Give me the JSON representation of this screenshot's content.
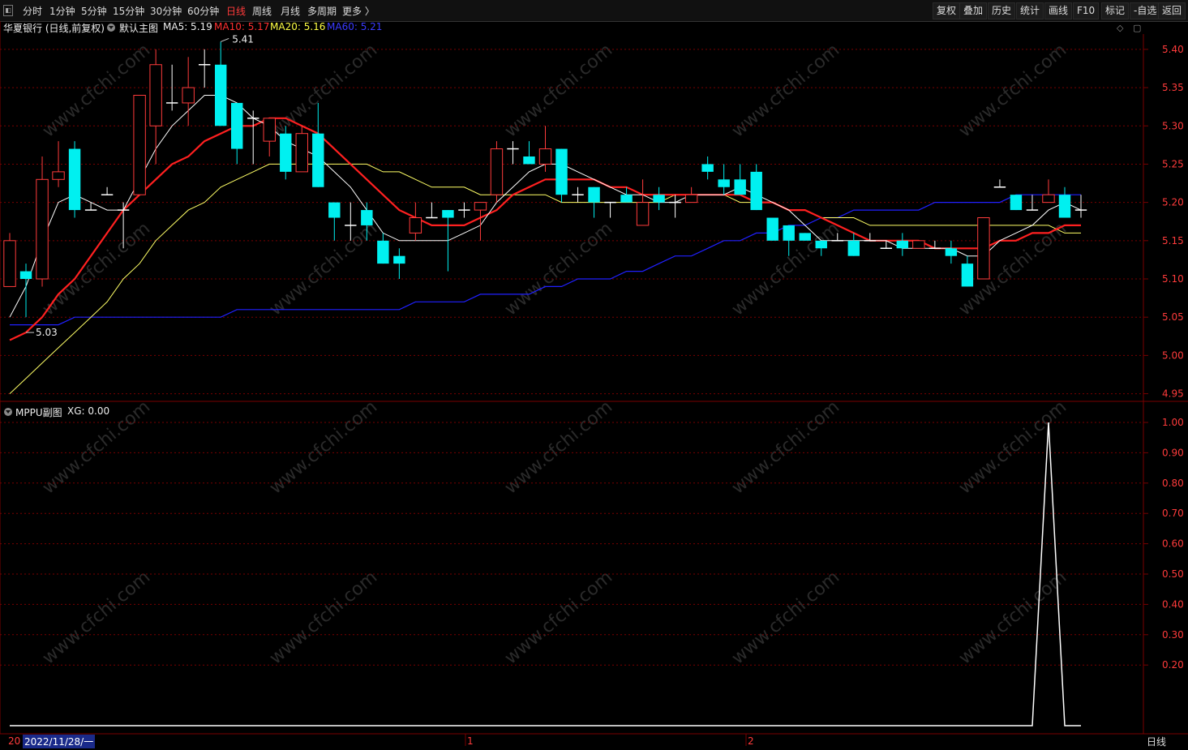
{
  "toolbar": {
    "left": [
      {
        "label": "分时",
        "active": false
      },
      {
        "label": "1分钟",
        "active": false
      },
      {
        "label": "5分钟",
        "active": false
      },
      {
        "label": "15分钟",
        "active": false
      },
      {
        "label": "30分钟",
        "active": false
      },
      {
        "label": "60分钟",
        "active": false
      },
      {
        "label": "日线",
        "active": true
      },
      {
        "label": "周线",
        "active": false
      },
      {
        "label": "月线",
        "active": false
      },
      {
        "label": "多周期",
        "active": false
      },
      {
        "label": "更多 〉",
        "active": false
      }
    ],
    "right": [
      "复权",
      "叠加",
      "历史",
      "统计",
      "画线",
      "F10",
      "标记",
      "-自选",
      "返回"
    ]
  },
  "main_info": {
    "stock": "华夏银行 (日线,前复权)",
    "template": "默认主图",
    "ma5": "MA5: 5.19",
    "ma10": "MA10: 5.17",
    "ma20": "MA20: 5.16",
    "ma60": "MA60: 5.21"
  },
  "sub_info": {
    "indicator": "MPPU副图",
    "xg": "XG: 0.00"
  },
  "colors": {
    "up": "#ff3b3b",
    "down": "#00f0f0",
    "ma5": "#ffffff",
    "ma10": "#ff2020",
    "ma20": "#ffff66",
    "ma60": "#2020ff",
    "grid": "#7a0000",
    "axis_text": "#ff3b3b"
  },
  "price_axis": {
    "ticks": [
      "5.40",
      "5.35",
      "5.30",
      "5.25",
      "5.20",
      "5.15",
      "5.10",
      "5.05",
      "5.00",
      "4.95"
    ]
  },
  "sub_axis": {
    "ticks": [
      "1.00",
      "0.90",
      "0.80",
      "0.70",
      "0.60",
      "0.50",
      "0.40",
      "0.30",
      "0.20"
    ]
  },
  "annotations": {
    "high": "5.41",
    "low": "5.03"
  },
  "bottom": {
    "date": "2022/11/28/一",
    "year_prefix": "20",
    "m1": "1",
    "m2": "2",
    "period": "日线"
  },
  "watermark": "www.cfchi.com",
  "chart_data": {
    "type": "candlestick",
    "candles": [
      [
        5.09,
        5.15,
        5.09,
        5.16
      ],
      [
        5.11,
        5.1,
        5.05,
        5.12
      ],
      [
        5.1,
        5.23,
        5.09,
        5.26
      ],
      [
        5.23,
        5.24,
        5.22,
        5.28
      ],
      [
        5.27,
        5.19,
        5.18,
        5.28
      ],
      [
        5.19,
        5.19,
        5.19,
        5.2
      ],
      [
        5.21,
        5.21,
        5.21,
        5.22
      ],
      [
        5.19,
        5.19,
        5.14,
        5.2
      ],
      [
        5.21,
        5.34,
        5.21,
        5.34
      ],
      [
        5.3,
        5.38,
        5.25,
        5.4
      ],
      [
        5.33,
        5.33,
        5.32,
        5.38
      ],
      [
        5.33,
        5.35,
        5.3,
        5.39
      ],
      [
        5.38,
        5.38,
        5.35,
        5.4
      ],
      [
        5.38,
        5.3,
        5.3,
        5.41
      ],
      [
        5.33,
        5.27,
        5.25,
        5.33
      ],
      [
        5.31,
        5.31,
        5.25,
        5.32
      ],
      [
        5.28,
        5.31,
        5.26,
        5.31
      ],
      [
        5.29,
        5.24,
        5.23,
        5.3
      ],
      [
        5.24,
        5.29,
        5.24,
        5.3
      ],
      [
        5.29,
        5.22,
        5.22,
        5.33
      ],
      [
        5.2,
        5.18,
        5.15,
        5.2
      ],
      [
        5.17,
        5.17,
        5.15,
        5.2
      ],
      [
        5.19,
        5.17,
        5.15,
        5.2
      ],
      [
        5.15,
        5.12,
        5.12,
        5.16
      ],
      [
        5.13,
        5.12,
        5.1,
        5.14
      ],
      [
        5.16,
        5.18,
        5.15,
        5.2
      ],
      [
        5.18,
        5.18,
        5.18,
        5.2
      ],
      [
        5.19,
        5.18,
        5.11,
        5.19
      ],
      [
        5.19,
        5.19,
        5.18,
        5.2
      ],
      [
        5.19,
        5.2,
        5.15,
        5.2
      ],
      [
        5.21,
        5.27,
        5.2,
        5.28
      ],
      [
        5.27,
        5.27,
        5.25,
        5.28
      ],
      [
        5.26,
        5.25,
        5.25,
        5.28
      ],
      [
        5.25,
        5.27,
        5.24,
        5.3
      ],
      [
        5.27,
        5.21,
        5.2,
        5.27
      ],
      [
        5.21,
        5.21,
        5.2,
        5.22
      ],
      [
        5.22,
        5.2,
        5.18,
        5.22
      ],
      [
        5.2,
        5.2,
        5.18,
        5.2
      ],
      [
        5.21,
        5.2,
        5.2,
        5.22
      ],
      [
        5.17,
        5.2,
        5.17,
        5.23
      ],
      [
        5.21,
        5.2,
        5.19,
        5.22
      ],
      [
        5.2,
        5.2,
        5.18,
        5.21
      ],
      [
        5.2,
        5.21,
        5.2,
        5.22
      ],
      [
        5.25,
        5.24,
        5.23,
        5.26
      ],
      [
        5.23,
        5.22,
        5.21,
        5.25
      ],
      [
        5.23,
        5.21,
        5.21,
        5.25
      ],
      [
        5.24,
        5.19,
        5.19,
        5.25
      ],
      [
        5.18,
        5.15,
        5.15,
        5.18
      ],
      [
        5.17,
        5.15,
        5.13,
        5.17
      ],
      [
        5.16,
        5.15,
        5.15,
        5.16
      ],
      [
        5.15,
        5.14,
        5.13,
        5.15
      ],
      [
        5.15,
        5.15,
        5.15,
        5.16
      ],
      [
        5.15,
        5.13,
        5.13,
        5.16
      ],
      [
        5.15,
        5.15,
        5.15,
        5.16
      ],
      [
        5.14,
        5.14,
        5.14,
        5.15
      ],
      [
        5.15,
        5.14,
        5.13,
        5.16
      ],
      [
        5.14,
        5.15,
        5.15,
        5.15
      ],
      [
        5.14,
        5.14,
        5.14,
        5.15
      ],
      [
        5.14,
        5.13,
        5.12,
        5.15
      ],
      [
        5.12,
        5.09,
        5.09,
        5.13
      ],
      [
        5.1,
        5.18,
        5.1,
        5.18
      ],
      [
        5.22,
        5.22,
        5.22,
        5.23
      ],
      [
        5.21,
        5.19,
        5.19,
        5.21
      ],
      [
        5.19,
        5.19,
        5.19,
        5.21
      ],
      [
        5.2,
        5.21,
        5.2,
        5.23
      ],
      [
        5.21,
        5.18,
        5.18,
        5.22
      ],
      [
        5.19,
        5.19,
        5.18,
        5.21
      ]
    ],
    "ma5": [
      5.05,
      5.09,
      5.15,
      5.2,
      5.21,
      5.2,
      5.19,
      5.19,
      5.23,
      5.27,
      5.3,
      5.32,
      5.34,
      5.34,
      5.33,
      5.31,
      5.3,
      5.28,
      5.27,
      5.26,
      5.24,
      5.22,
      5.19,
      5.16,
      5.15,
      5.15,
      5.15,
      5.15,
      5.16,
      5.17,
      5.2,
      5.22,
      5.24,
      5.25,
      5.25,
      5.24,
      5.23,
      5.22,
      5.21,
      5.21,
      5.2,
      5.2,
      5.21,
      5.21,
      5.21,
      5.22,
      5.21,
      5.2,
      5.19,
      5.17,
      5.15,
      5.15,
      5.15,
      5.15,
      5.15,
      5.14,
      5.14,
      5.14,
      5.14,
      5.13,
      5.13,
      5.15,
      5.16,
      5.17,
      5.19,
      5.2,
      5.19
    ],
    "ma10": [
      5.02,
      5.03,
      5.05,
      5.08,
      5.1,
      5.13,
      5.16,
      5.19,
      5.21,
      5.23,
      5.25,
      5.26,
      5.28,
      5.29,
      5.3,
      5.3,
      5.31,
      5.31,
      5.3,
      5.29,
      5.27,
      5.25,
      5.23,
      5.21,
      5.19,
      5.18,
      5.17,
      5.17,
      5.17,
      5.18,
      5.19,
      5.21,
      5.22,
      5.23,
      5.23,
      5.23,
      5.23,
      5.22,
      5.22,
      5.21,
      5.21,
      5.21,
      5.21,
      5.21,
      5.21,
      5.21,
      5.2,
      5.2,
      5.19,
      5.19,
      5.18,
      5.17,
      5.16,
      5.15,
      5.15,
      5.15,
      5.15,
      5.14,
      5.14,
      5.14,
      5.14,
      5.15,
      5.15,
      5.16,
      5.16,
      5.17,
      5.17
    ],
    "ma20": [
      4.95,
      4.97,
      4.99,
      5.01,
      5.03,
      5.05,
      5.07,
      5.1,
      5.12,
      5.15,
      5.17,
      5.19,
      5.2,
      5.22,
      5.23,
      5.24,
      5.25,
      5.25,
      5.25,
      5.25,
      5.25,
      5.25,
      5.25,
      5.24,
      5.24,
      5.23,
      5.22,
      5.22,
      5.22,
      5.21,
      5.21,
      5.21,
      5.21,
      5.21,
      5.2,
      5.2,
      5.2,
      5.2,
      5.2,
      5.2,
      5.2,
      5.21,
      5.21,
      5.21,
      5.21,
      5.2,
      5.2,
      5.2,
      5.19,
      5.19,
      5.18,
      5.18,
      5.18,
      5.17,
      5.17,
      5.17,
      5.17,
      5.17,
      5.17,
      5.17,
      5.17,
      5.17,
      5.17,
      5.17,
      5.17,
      5.16,
      5.16
    ],
    "ma60": [
      5.04,
      5.04,
      5.04,
      5.04,
      5.05,
      5.05,
      5.05,
      5.05,
      5.05,
      5.05,
      5.05,
      5.05,
      5.05,
      5.05,
      5.06,
      5.06,
      5.06,
      5.06,
      5.06,
      5.06,
      5.06,
      5.06,
      5.06,
      5.06,
      5.06,
      5.07,
      5.07,
      5.07,
      5.07,
      5.08,
      5.08,
      5.08,
      5.08,
      5.09,
      5.09,
      5.1,
      5.1,
      5.1,
      5.11,
      5.11,
      5.12,
      5.13,
      5.13,
      5.14,
      5.15,
      5.15,
      5.16,
      5.16,
      5.17,
      5.17,
      5.18,
      5.18,
      5.19,
      5.19,
      5.19,
      5.19,
      5.19,
      5.2,
      5.2,
      5.2,
      5.2,
      5.2,
      5.21,
      5.21,
      5.21,
      5.21,
      5.21
    ],
    "price_ylim": [
      4.94,
      5.42
    ],
    "mppu": [
      0,
      0,
      0,
      0,
      0,
      0,
      0,
      0,
      0,
      0,
      0,
      0,
      0,
      0,
      0,
      0,
      0,
      0,
      0,
      0,
      0,
      0,
      0,
      0,
      0,
      0,
      0,
      0,
      0,
      0,
      0,
      0,
      0,
      0,
      0,
      0,
      0,
      0,
      0,
      0,
      0,
      0,
      0,
      0,
      0,
      0,
      0,
      0,
      0,
      0,
      0,
      0,
      0,
      0,
      0,
      0,
      0,
      0,
      0,
      0,
      0,
      0,
      0,
      0,
      1,
      0,
      0
    ],
    "mppu_ylim": [
      0,
      1.0
    ]
  }
}
